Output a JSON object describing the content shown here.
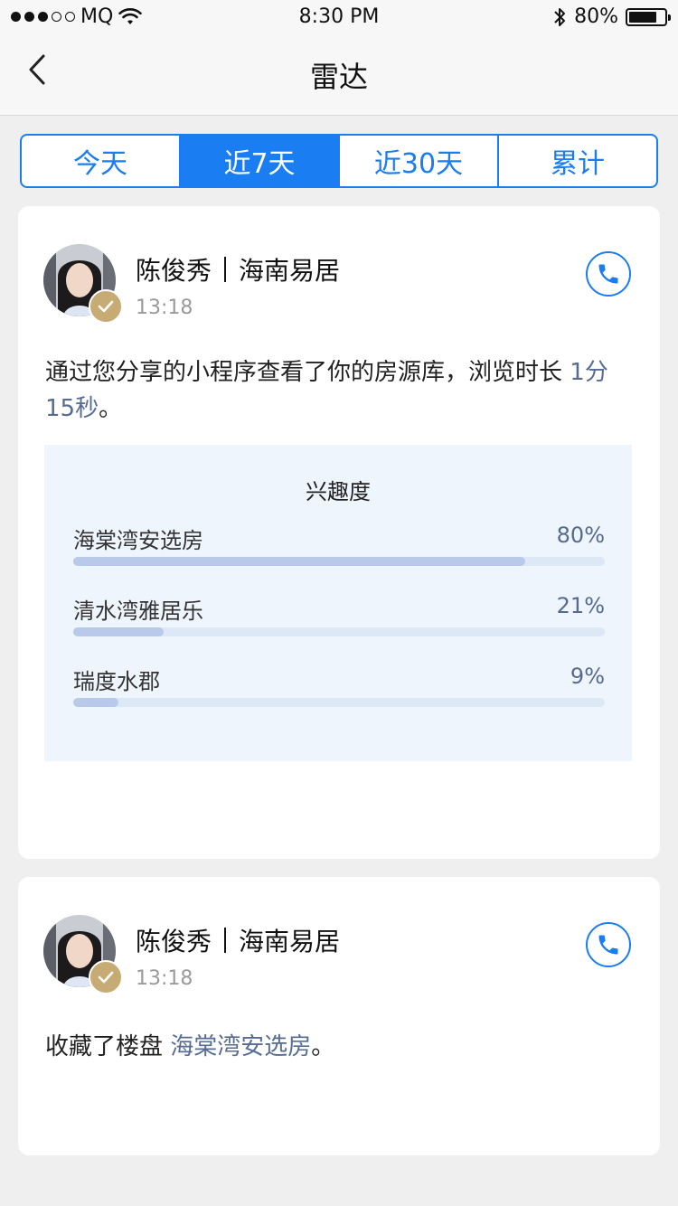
{
  "status_bar": {
    "carrier": "MQ",
    "time": "8:30 PM",
    "battery_text": "80%",
    "battery_level": 0.8,
    "signal_bars_filled": 3,
    "signal_bars_total": 5
  },
  "nav": {
    "title": "雷达"
  },
  "tabs": [
    {
      "label": "今天",
      "active": false
    },
    {
      "label": "近7天",
      "active": true
    },
    {
      "label": "近30天",
      "active": false
    },
    {
      "label": "累计",
      "active": false
    }
  ],
  "cards": [
    {
      "name": "陈俊秀",
      "company": "海南易居",
      "time": "13:18",
      "desc_prefix": "通过您分享的小程序查看了你的房源库，浏览时长",
      "desc_highlight": " 1分15秒",
      "desc_suffix": "。",
      "interest": {
        "title": "兴趣度",
        "items": [
          {
            "label": "海棠湾安选房",
            "pct_text": "80%",
            "value": 0.85
          },
          {
            "label": "清水湾雅居乐",
            "pct_text": "21%",
            "value": 0.17
          },
          {
            "label": "瑞度水郡",
            "pct_text": "9%",
            "value": 0.085
          }
        ]
      }
    },
    {
      "name": "陈俊秀",
      "company": "海南易居",
      "time": "13:18",
      "desc_prefix": "收藏了楼盘 ",
      "desc_highlight": "海棠湾安选房",
      "desc_suffix": "。"
    }
  ],
  "colors": {
    "accent": "#1a7df2",
    "badge": "#c7ab74",
    "highlight_text": "#566c92",
    "bar_fill": "#b8c9e9",
    "panel_bg": "#eff5fd"
  },
  "icons": {
    "back": "chevron-left-icon",
    "call": "phone-icon",
    "verified": "checkmark-icon",
    "wifi": "wifi-icon",
    "bluetooth": "bluetooth-icon",
    "battery": "battery-icon"
  }
}
